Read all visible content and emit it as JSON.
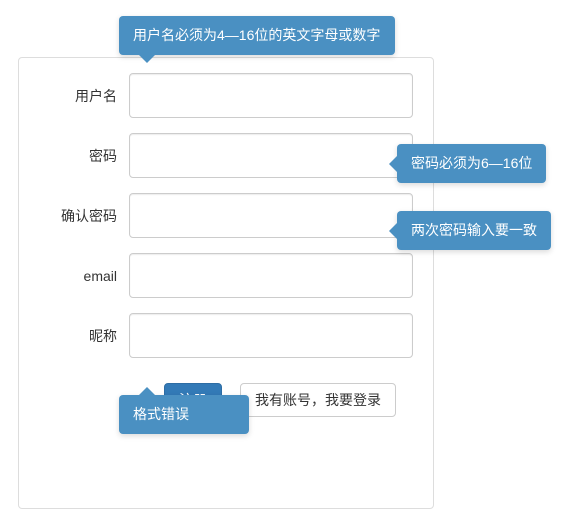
{
  "form": {
    "username_label": "用户名",
    "password_label": "密码",
    "confirm_label": "确认密码",
    "email_label": "email",
    "nickname_label": "昵称",
    "username_value": "",
    "password_value": "",
    "confirm_value": "",
    "email_value": "",
    "nickname_value": ""
  },
  "buttons": {
    "register": "注册",
    "login_link": "我有账号，我要登录"
  },
  "popovers": {
    "username_hint": "用户名必须为4—16位的英文字母或数字",
    "password_hint": "密码必须为6—16位",
    "confirm_hint": "两次密码输入要一致",
    "nickname_error": "格式错误"
  },
  "colors": {
    "popover_bg": "#4a90c2",
    "btn_primary": "#337ab7"
  }
}
